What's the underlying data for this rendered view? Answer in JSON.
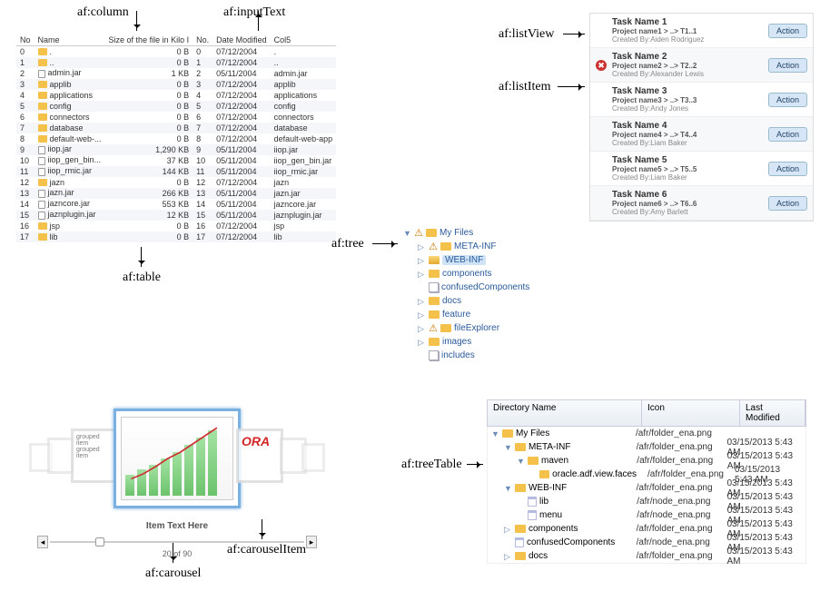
{
  "labels": {
    "column": "af:column",
    "inputText": "af:inputText",
    "table": "af:table",
    "tree": "af:tree",
    "listView": "af:listView",
    "listItem": "af:listItem",
    "carousel": "af:carousel",
    "carouselItem": "af:carouselItem",
    "treeTable": "af:treeTable"
  },
  "table": {
    "headers": {
      "no": "No",
      "name": "Name",
      "size": "Size of the file in Kilo I",
      "no2": "No.",
      "date": "Date Modified",
      "col5": "Col5"
    },
    "rows": [
      {
        "no": "0",
        "name": ".",
        "icon": "folder",
        "size": "0 B",
        "no2": "0",
        "date": "07/12/2004",
        "col5": "."
      },
      {
        "no": "1",
        "name": "..",
        "icon": "folder",
        "size": "0 B",
        "no2": "1",
        "date": "07/12/2004",
        "col5": ".."
      },
      {
        "no": "2",
        "name": "admin.jar",
        "icon": "file",
        "size": "1 KB",
        "no2": "2",
        "date": "05/11/2004",
        "col5": "admin.jar"
      },
      {
        "no": "3",
        "name": "applib",
        "icon": "folder",
        "size": "0 B",
        "no2": "3",
        "date": "07/12/2004",
        "col5": "applib"
      },
      {
        "no": "4",
        "name": "applications",
        "icon": "folder",
        "size": "0 B",
        "no2": "4",
        "date": "07/12/2004",
        "col5": "applications"
      },
      {
        "no": "5",
        "name": "config",
        "icon": "folder",
        "size": "0 B",
        "no2": "5",
        "date": "07/12/2004",
        "col5": "config"
      },
      {
        "no": "6",
        "name": "connectors",
        "icon": "folder",
        "size": "0 B",
        "no2": "6",
        "date": "07/12/2004",
        "col5": "connectors"
      },
      {
        "no": "7",
        "name": "database",
        "icon": "folder",
        "size": "0 B",
        "no2": "7",
        "date": "07/12/2004",
        "col5": "database"
      },
      {
        "no": "8",
        "name": "default-web-...",
        "icon": "folder",
        "size": "0 B",
        "no2": "8",
        "date": "07/12/2004",
        "col5": "default-web-app"
      },
      {
        "no": "9",
        "name": "iiop.jar",
        "icon": "file",
        "size": "1,290 KB",
        "no2": "9",
        "date": "05/11/2004",
        "col5": "iiop.jar"
      },
      {
        "no": "10",
        "name": "iiop_gen_bin...",
        "icon": "file",
        "size": "37 KB",
        "no2": "10",
        "date": "05/11/2004",
        "col5": "iiop_gen_bin.jar"
      },
      {
        "no": "11",
        "name": "iiop_rmic.jar",
        "icon": "file",
        "size": "144 KB",
        "no2": "11",
        "date": "05/11/2004",
        "col5": "iiop_rmic.jar"
      },
      {
        "no": "12",
        "name": "jazn",
        "icon": "folder",
        "size": "0 B",
        "no2": "12",
        "date": "07/12/2004",
        "col5": "jazn"
      },
      {
        "no": "13",
        "name": "jazn.jar",
        "icon": "file",
        "size": "266 KB",
        "no2": "13",
        "date": "05/11/2004",
        "col5": "jazn.jar"
      },
      {
        "no": "14",
        "name": "jazncore.jar",
        "icon": "file",
        "size": "553 KB",
        "no2": "14",
        "date": "05/11/2004",
        "col5": "jazncore.jar"
      },
      {
        "no": "15",
        "name": "jaznplugin.jar",
        "icon": "file",
        "size": "12 KB",
        "no2": "15",
        "date": "05/11/2004",
        "col5": "jaznplugin.jar"
      },
      {
        "no": "16",
        "name": "jsp",
        "icon": "folder",
        "size": "0 B",
        "no2": "16",
        "date": "07/12/2004",
        "col5": "jsp"
      },
      {
        "no": "17",
        "name": "lib",
        "icon": "folder",
        "size": "0 B",
        "no2": "17",
        "date": "07/12/2004",
        "col5": "lib"
      }
    ]
  },
  "listView": {
    "actionLabel": "Action",
    "items": [
      {
        "title": "Task Name 1",
        "sub": "Project name1 > ..> T1..1",
        "meta": "Created By:Aiden Rodriguez",
        "err": false
      },
      {
        "title": "Task Name 2",
        "sub": "Project name2 > ..> T2..2",
        "meta": "Created By:Alexander Lewis",
        "err": true
      },
      {
        "title": "Task Name 3",
        "sub": "Project name3 > ..> T3..3",
        "meta": "Created By:Andy Jones",
        "err": false
      },
      {
        "title": "Task Name 4",
        "sub": "Project name4 > ..> T4..4",
        "meta": "Created By:Liam Baker",
        "err": false
      },
      {
        "title": "Task Name 5",
        "sub": "Project name5 > ..> T5..5",
        "meta": "Created By:Liam Baker",
        "err": false
      },
      {
        "title": "Task Name 6",
        "sub": "Project name6 > ..> T6..6",
        "meta": "Created By:Amy Barlett",
        "err": false
      }
    ]
  },
  "tree": {
    "nodes": [
      {
        "level": 0,
        "expander": "down",
        "warn": true,
        "icon": "folder",
        "label": "My Files",
        "sel": false
      },
      {
        "level": 1,
        "expander": "right",
        "warn": true,
        "icon": "folder",
        "label": "META-INF",
        "sel": false
      },
      {
        "level": 1,
        "expander": "right",
        "warn": false,
        "icon": "folder-open",
        "label": "WEB-INF",
        "sel": true
      },
      {
        "level": 1,
        "expander": "right",
        "warn": false,
        "icon": "folder",
        "label": "components",
        "sel": false
      },
      {
        "level": 1,
        "expander": "none",
        "warn": false,
        "icon": "pile",
        "label": "confusedComponents",
        "sel": false
      },
      {
        "level": 1,
        "expander": "right",
        "warn": false,
        "icon": "folder",
        "label": "docs",
        "sel": false
      },
      {
        "level": 1,
        "expander": "right",
        "warn": false,
        "icon": "folder",
        "label": "feature",
        "sel": false
      },
      {
        "level": 1,
        "expander": "right",
        "warn": true,
        "icon": "folder",
        "label": "fileExplorer",
        "sel": false
      },
      {
        "level": 1,
        "expander": "right",
        "warn": false,
        "icon": "folder",
        "label": "images",
        "sel": false
      },
      {
        "level": 1,
        "expander": "none",
        "warn": false,
        "icon": "pile",
        "label": "includes",
        "sel": false
      }
    ]
  },
  "carousel": {
    "groupedText": "grouped item",
    "oraText": "ORA",
    "caption": "Item Text Here",
    "count": "20 of 90"
  },
  "treeTable": {
    "headers": {
      "name": "Directory Name",
      "icon": "Icon",
      "modified": "Last Modified"
    },
    "rows": [
      {
        "i": 0,
        "exp": "down",
        "ic": "folder",
        "name": "My Files",
        "path": "/afr/folder_ena.png",
        "mod": ""
      },
      {
        "i": 1,
        "exp": "down",
        "ic": "folder",
        "name": "META-INF",
        "path": "/afr/folder_ena.png",
        "mod": "03/15/2013 5:43 AM"
      },
      {
        "i": 2,
        "exp": "down",
        "ic": "folder",
        "name": "maven",
        "path": "/afr/folder_ena.png",
        "mod": "03/15/2013 5:43 AM"
      },
      {
        "i": 3,
        "exp": "none",
        "ic": "folder",
        "name": "oracle.adf.view.faces",
        "path": "/afr/folder_ena.png",
        "mod": "03/15/2013 5:43 AM"
      },
      {
        "i": 1,
        "exp": "down",
        "ic": "folder",
        "name": "WEB-INF",
        "path": "/afr/folder_ena.png",
        "mod": "03/15/2013 5:43 AM"
      },
      {
        "i": 2,
        "exp": "none",
        "ic": "doc",
        "name": "lib",
        "path": "/afr/node_ena.png",
        "mod": "03/15/2013 5:43 AM"
      },
      {
        "i": 2,
        "exp": "none",
        "ic": "doc",
        "name": "menu",
        "path": "/afr/node_ena.png",
        "mod": "03/15/2013 5:43 AM"
      },
      {
        "i": 1,
        "exp": "right",
        "ic": "folder",
        "name": "components",
        "path": "/afr/folder_ena.png",
        "mod": "03/15/2013 5:43 AM"
      },
      {
        "i": 1,
        "exp": "none",
        "ic": "doc",
        "name": "confusedComponents",
        "path": "/afr/node_ena.png",
        "mod": "03/15/2013 5:43 AM"
      },
      {
        "i": 1,
        "exp": "right",
        "ic": "folder",
        "name": "docs",
        "path": "/afr/folder_ena.png",
        "mod": "03/15/2013 5:43 AM"
      }
    ]
  }
}
